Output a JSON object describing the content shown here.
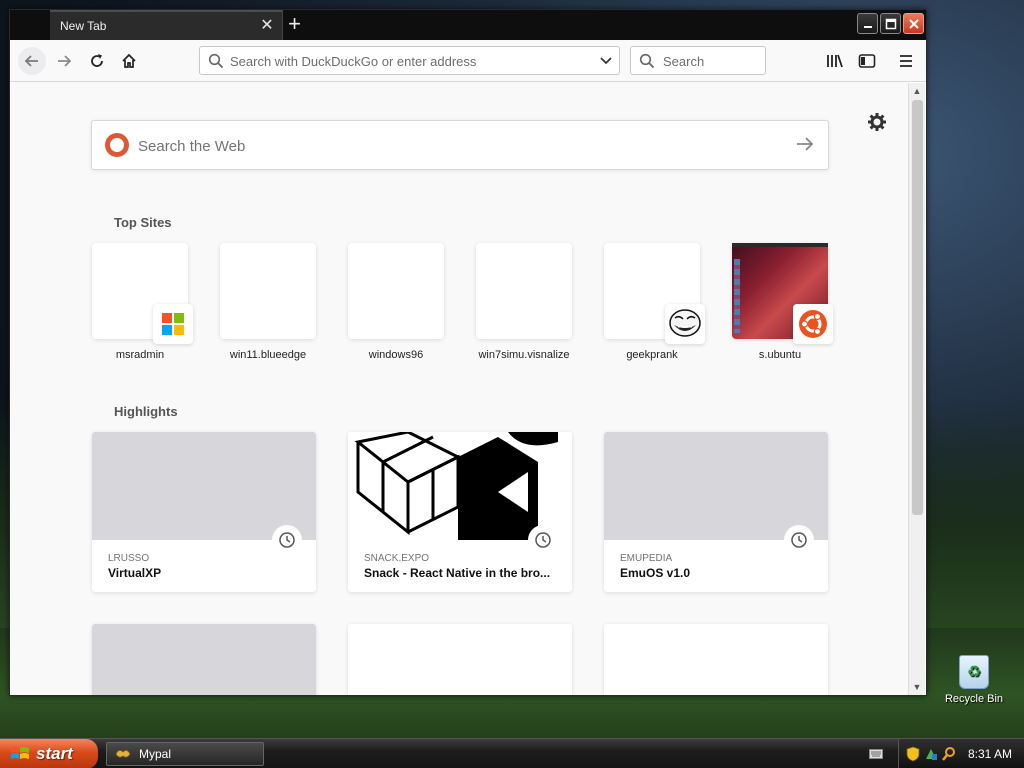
{
  "browser": {
    "tab": {
      "title": "New Tab"
    },
    "urlbar": {
      "placeholder": "Search with DuckDuckGo or enter address"
    },
    "searchbar": {
      "placeholder": "Search"
    }
  },
  "newtab": {
    "web_search": {
      "placeholder": "Search the Web"
    },
    "top_sites": {
      "title": "Top Sites",
      "items": [
        {
          "label": "msradmin",
          "icon": "windows-logo-icon"
        },
        {
          "label": "win11.blueedge",
          "icon": ""
        },
        {
          "label": "windows96",
          "icon": ""
        },
        {
          "label": "win7simu.visnalize",
          "icon": ""
        },
        {
          "label": "geekprank",
          "icon": "trollface-icon"
        },
        {
          "label": "s.ubuntu",
          "icon": "ubuntu-logo-icon"
        }
      ]
    },
    "highlights": {
      "title": "Highlights",
      "items": [
        {
          "source": "LRUSSO",
          "title": "VirtualXP"
        },
        {
          "source": "SNACK.EXPO",
          "title": "Snack - React Native in the bro..."
        },
        {
          "source": "EMUPEDIA",
          "title": "EmuOS v1.0"
        }
      ]
    }
  },
  "taskbar": {
    "start_label": "start",
    "task_label": "Mypal",
    "clock": "8:31 AM"
  },
  "desktop": {
    "recycle_bin_label": "Recycle Bin"
  },
  "colors": {
    "start_button": "#d94a1a",
    "duckduckgo_brand": "#de5833",
    "ubuntu_brand": "#e95420",
    "close_button": "#c8381e"
  }
}
